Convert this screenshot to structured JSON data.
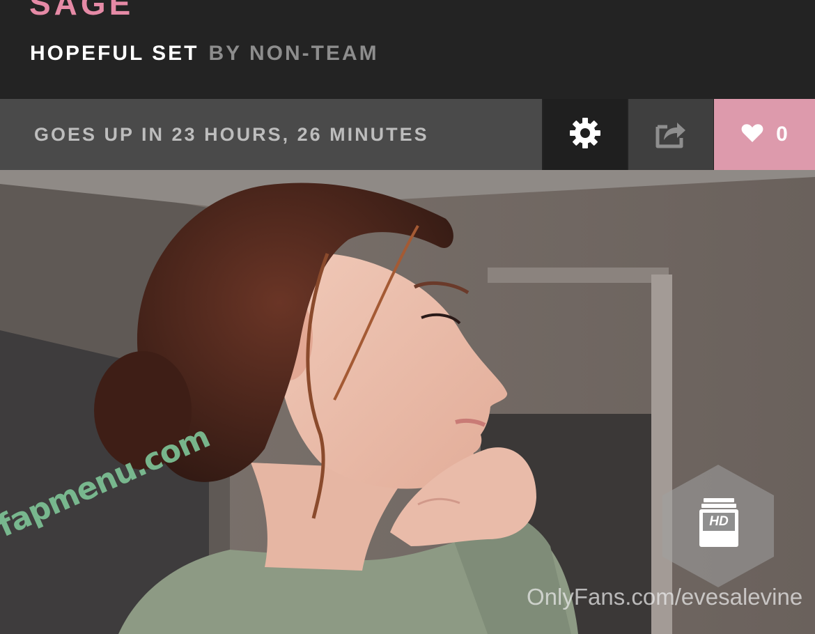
{
  "header": {
    "model_name": "SAGE",
    "set_title": "HOPEFUL SET",
    "set_by": "BY NON-TEAM"
  },
  "toolbar": {
    "countdown": "GOES UP IN 23 HOURS, 26 MINUTES",
    "settings_icon": "gear-icon",
    "share_icon": "share-icon",
    "like_icon": "heart-icon",
    "like_count": "0"
  },
  "photo": {
    "watermark": "fapmenu.com",
    "source_watermark": "OnlyFans.com/evesalevine",
    "badge_label": "HD"
  },
  "colors": {
    "accent_pink": "#e58aa6",
    "like_bg": "#dd9aac",
    "countdown_bg": "#4a4a4a",
    "background": "#232323"
  }
}
